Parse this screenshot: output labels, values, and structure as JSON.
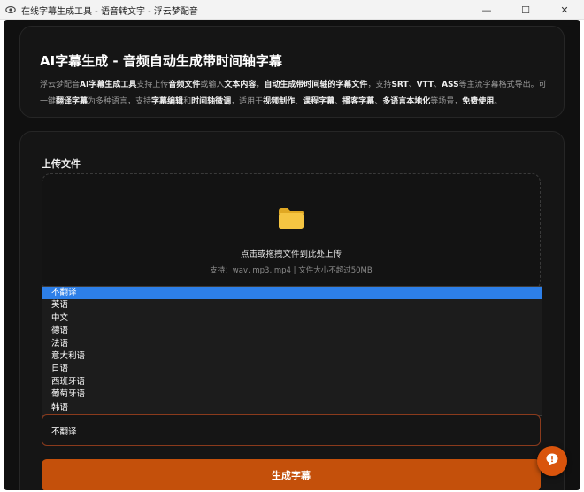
{
  "window": {
    "title": "在线字幕生成工具 - 语音转文字 - 浮云梦配音",
    "controls": {
      "minimize": "—",
      "maximize": "☐",
      "close": "✕"
    }
  },
  "header": {
    "title": "AI字幕生成 - 音频自动生成带时间轴字幕",
    "intro": {
      "p1": "浮云梦配音",
      "b1": "AI字幕生成工具",
      "p2": "支持上传",
      "b2": "音频文件",
      "p3": "或输入",
      "b3": "文本内容",
      "p4": "，",
      "b4": "自动生成带时间轴的字幕文件",
      "p5": "，支持",
      "b5": "SRT",
      "p6": "、",
      "b6": "VTT",
      "p7": "、",
      "b7": "ASS",
      "p8": "等主流字幕格式导出。可一键",
      "b8": "翻译字幕",
      "p9": "为多种语言，支持",
      "b9": "字幕编辑",
      "p10": "和",
      "b10": "时间轴微调",
      "p11": "，适用于",
      "b11": "视频制作",
      "p12": "、",
      "b12": "课程字幕",
      "p13": "、",
      "b13": "播客字幕",
      "p14": "、",
      "b14": "多语言本地化",
      "p15": "等场景，",
      "b15": "免费使用",
      "p16": "。"
    }
  },
  "upload": {
    "label": "上传文件",
    "drop_text": "点击或拖拽文件到此处上传",
    "hint": "支持：wav, mp3, mp4 | 文件大小不超过50MB"
  },
  "translate": {
    "options": [
      "不翻译",
      "英语",
      "中文",
      "德语",
      "法语",
      "意大利语",
      "日语",
      "西班牙语",
      "葡萄牙语",
      "韩语"
    ],
    "selected": "不翻译"
  },
  "generate_label": "生成字幕",
  "colors": {
    "accent": "#c4500b",
    "selection": "#2d7fe8",
    "folder": "#f5c542"
  },
  "icons": {
    "app": "eye-icon",
    "folder": "folder-icon",
    "fab": "chat-icon"
  }
}
